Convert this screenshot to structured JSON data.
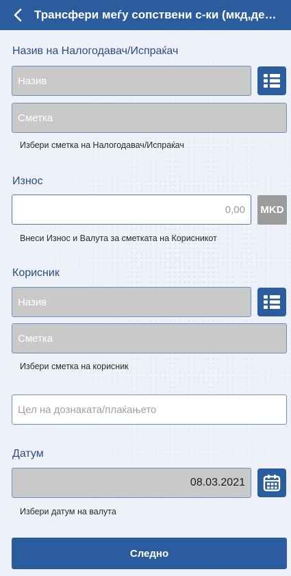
{
  "header": {
    "title": "Трансфери меѓу сопствени с-ки (мкд,деви..."
  },
  "payer": {
    "label": "Назив на Налогодавач/Испраќач",
    "name_placeholder": "Назив",
    "account_placeholder": "Сметка",
    "helper": "Избери сметка на Налогодавач/Испраќач"
  },
  "amount": {
    "label": "Износ",
    "value": "0,00",
    "currency": "MKD",
    "helper": "Внеси Износ и Валута за сметката на Корисникот"
  },
  "beneficiary": {
    "label": "Корисник",
    "name_placeholder": "Назив",
    "account_placeholder": "Сметка",
    "helper": "Избери сметка на корисник"
  },
  "purpose": {
    "placeholder": "Цел на дознаката/плаќањето"
  },
  "date": {
    "label": "Датум",
    "value": "08.03.2021",
    "helper": "Избери датум на валута"
  },
  "footer": {
    "next_label": "Следно"
  },
  "colors": {
    "primary": "#2b5d9e",
    "disabled_field": "#c9c9c9",
    "currency_box": "#9b9b9b",
    "label_text": "#2a4d7f"
  },
  "icons": {
    "back": "chevron-left-icon",
    "list": "list-icon",
    "calendar": "calendar-icon"
  }
}
